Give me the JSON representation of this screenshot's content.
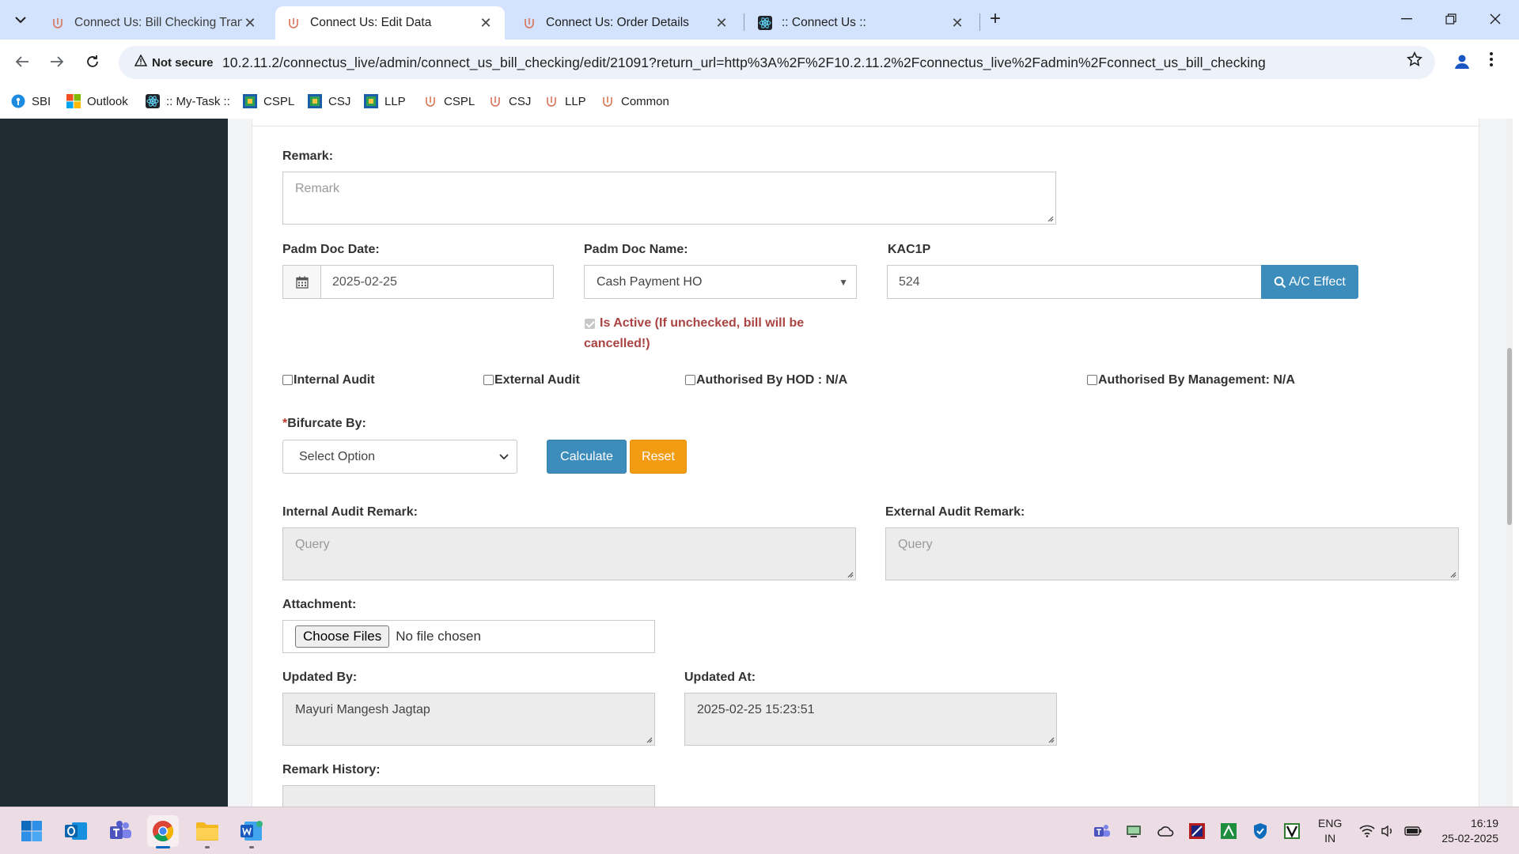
{
  "browser": {
    "tabs": [
      {
        "title": "Connect Us: Bill Checking Trans",
        "active": false
      },
      {
        "title": "Connect Us: Edit Data",
        "active": true
      },
      {
        "title": "Connect Us: Order Details",
        "active": false
      },
      {
        "title": ":: Connect Us ::",
        "active": false
      }
    ],
    "security_label": "Not secure",
    "url": "10.2.11.2/connectus_live/admin/connect_us_bill_checking/edit/21091?return_url=http%3A%2F%2F10.2.11.2%2Fconnectus_live%2Fadmin%2Fconnect_us_bill_checking",
    "bookmarks": [
      {
        "label": "SBI",
        "icon": "sbi-icon"
      },
      {
        "label": "Outlook",
        "icon": "microsoft-icon"
      },
      {
        "label": ":: My-Task ::",
        "icon": "react-icon"
      },
      {
        "label": "CSPL",
        "icon": "app-icon"
      },
      {
        "label": "CSJ",
        "icon": "app-icon"
      },
      {
        "label": "LLP",
        "icon": "app-icon"
      },
      {
        "label": "CSPL",
        "icon": "connectus-icon"
      },
      {
        "label": "CSJ",
        "icon": "connectus-icon"
      },
      {
        "label": "LLP",
        "icon": "connectus-icon"
      },
      {
        "label": "Common",
        "icon": "connectus-icon"
      }
    ]
  },
  "form": {
    "remark": {
      "label": "Remark:",
      "placeholder": "Remark"
    },
    "padm_doc_date": {
      "label": "Padm Doc Date:",
      "value": "2025-02-25"
    },
    "padm_doc_name": {
      "label": "Padm Doc Name:",
      "value": "Cash Payment HO"
    },
    "kac1p": {
      "label": "KAC1P",
      "value": "524",
      "button": "A/C Effect"
    },
    "is_active": {
      "label": "Is Active (If unchecked, bill will be cancelled!)",
      "checked": true
    },
    "checkboxes": [
      {
        "label": "Internal Audit",
        "checked": false
      },
      {
        "label": "External Audit",
        "checked": false
      },
      {
        "label": "Authorised By HOD : N/A",
        "checked": false
      },
      {
        "label": "Authorised By Management: N/A",
        "checked": false
      }
    ],
    "bifurcate": {
      "required_mark": "*",
      "label": "Bifurcate By:",
      "value": "Select Option"
    },
    "calculate_button": "Calculate",
    "reset_button": "Reset",
    "internal_audit_remark": {
      "label": "Internal Audit Remark:",
      "placeholder": "Query"
    },
    "external_audit_remark": {
      "label": "External Audit Remark:",
      "placeholder": "Query"
    },
    "attachment": {
      "label": "Attachment:",
      "button": "Choose Files",
      "status": "No file chosen"
    },
    "updated_by": {
      "label": "Updated By:",
      "value": "Mayuri Mangesh Jagtap"
    },
    "updated_at": {
      "label": "Updated At:",
      "value": "2025-02-25 15:23:51"
    },
    "remark_history": {
      "label": "Remark History:"
    }
  },
  "taskbar": {
    "lang_line1": "ENG",
    "lang_line2": "IN",
    "time": "16:19",
    "date": "25-02-2025"
  },
  "colors": {
    "primary_button": "#3c8dbc",
    "warning_button": "#f39c12",
    "sidebar": "#1f2d33",
    "danger_text": "#a94442"
  }
}
